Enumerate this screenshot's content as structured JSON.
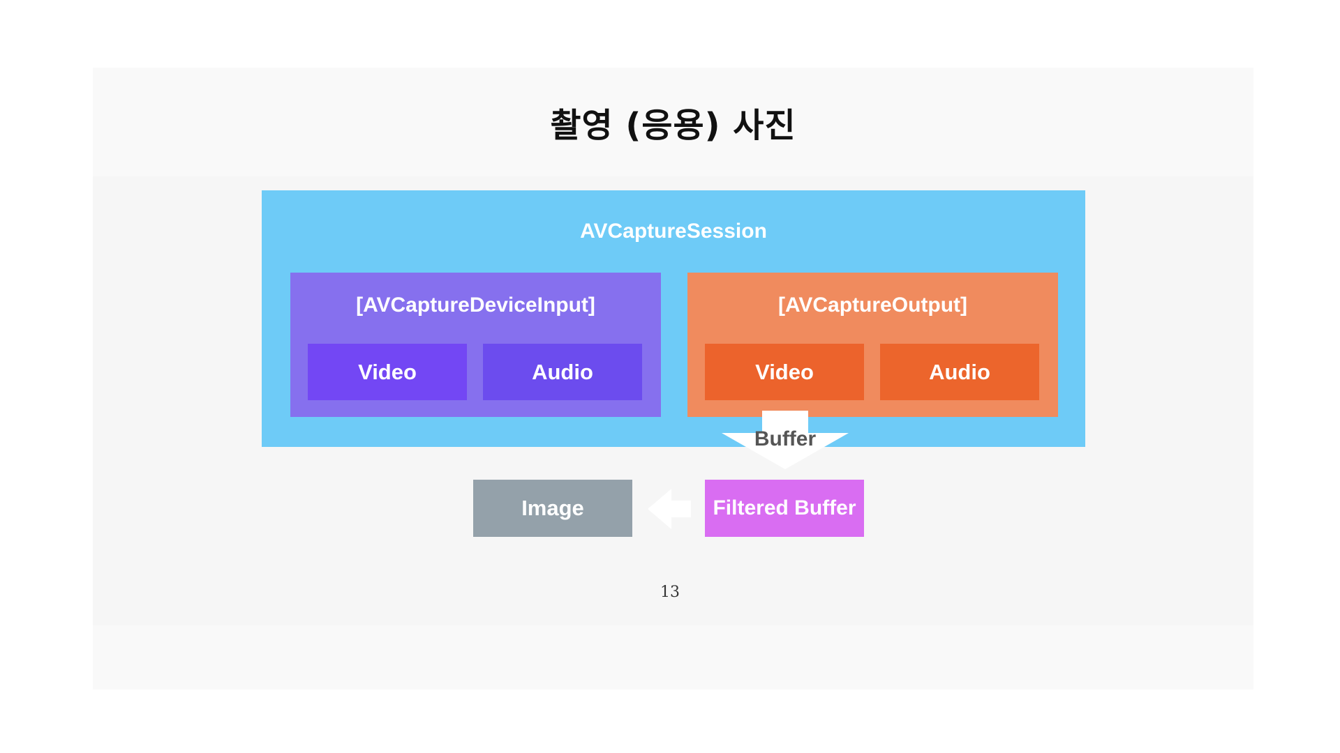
{
  "slide": {
    "title": "촬영 (응용) 사진",
    "page_number": "13"
  },
  "diagram": {
    "session_label": "AVCaptureSession",
    "input_group": {
      "label": "[AVCaptureDeviceInput]",
      "items": [
        "Video",
        "Audio"
      ]
    },
    "output_group": {
      "label": "[AVCaptureOutput]",
      "items": [
        "Video",
        "Audio"
      ]
    },
    "buffer_label": "Buffer",
    "filtered_label": "Filtered Buffer",
    "image_label": "Image"
  },
  "colors": {
    "session": "#6ecbf7",
    "input_group": "#8670ee",
    "input_chip": "#7347f4",
    "output_group": "#f08b5e",
    "output_chip": "#ec632c",
    "filtered": "#d96df2",
    "image": "#94a1aa",
    "arrow": "#ffffff"
  },
  "icons": {
    "flow_down": "down-arrow-icon",
    "flow_left": "left-arrow-icon"
  }
}
